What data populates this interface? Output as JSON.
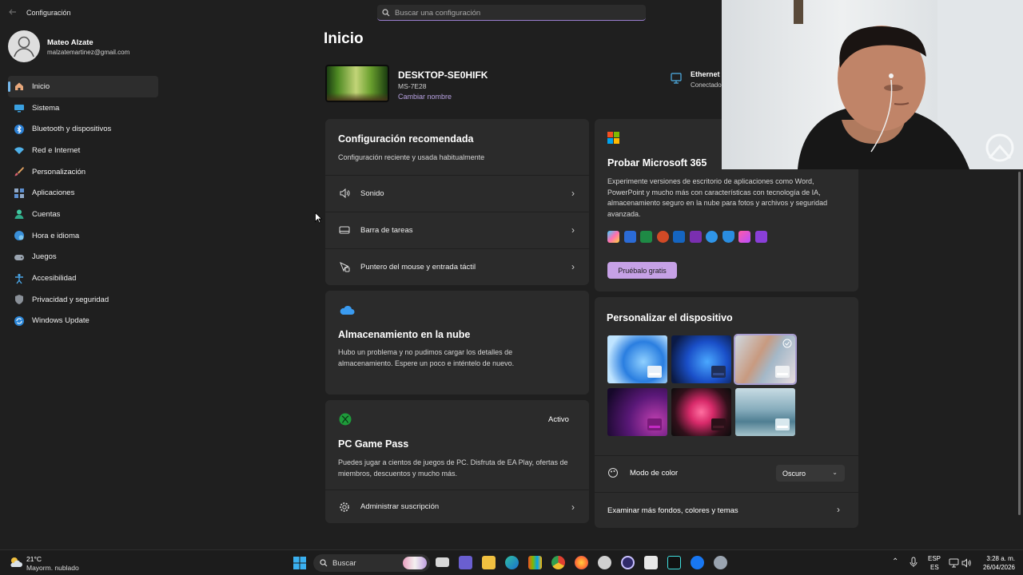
{
  "app": {
    "title": "Configuración"
  },
  "search": {
    "placeholder": "Buscar una configuración"
  },
  "user": {
    "name": "Mateo Alzate",
    "email": "malzatemartinez@gmail.com"
  },
  "sidebar": {
    "items": [
      {
        "label": "Inicio",
        "icon": "home-icon",
        "active": true
      },
      {
        "label": "Sistema",
        "icon": "monitor-icon"
      },
      {
        "label": "Bluetooth y dispositivos",
        "icon": "bluetooth-icon"
      },
      {
        "label": "Red e Internet",
        "icon": "wifi-icon"
      },
      {
        "label": "Personalización",
        "icon": "brush-icon"
      },
      {
        "label": "Aplicaciones",
        "icon": "apps-icon"
      },
      {
        "label": "Cuentas",
        "icon": "person-icon"
      },
      {
        "label": "Hora e idioma",
        "icon": "globe-clock-icon"
      },
      {
        "label": "Juegos",
        "icon": "gamepad-icon"
      },
      {
        "label": "Accesibilidad",
        "icon": "accessibility-icon"
      },
      {
        "label": "Privacidad y seguridad",
        "icon": "shield-icon"
      },
      {
        "label": "Windows Update",
        "icon": "update-icon"
      }
    ]
  },
  "main": {
    "title": "Inicio",
    "device": {
      "name": "DESKTOP-SE0HIFK",
      "model": "MS-7E28",
      "rename": "Cambiar nombre"
    },
    "network": {
      "name": "Ethernet",
      "status": "Conectado"
    },
    "recommended": {
      "title": "Configuración recomendada",
      "subtitle": "Configuración reciente y usada habitualmente",
      "rows": [
        {
          "label": "Sonido",
          "icon": "speaker-icon"
        },
        {
          "label": "Barra de tareas",
          "icon": "taskbar-icon"
        },
        {
          "label": "Puntero del mouse y entrada táctil",
          "icon": "pointer-icon"
        }
      ]
    },
    "cloud": {
      "title": "Almacenamiento en la nube",
      "text": "Hubo un problema y no pudimos cargar los detalles de almacenamiento. Espere un poco e inténtelo de nuevo."
    },
    "gamepass": {
      "title": "PC Game Pass",
      "status": "Activo",
      "text": "Puedes jugar a cientos de juegos de PC. Disfruta de EA Play, ofertas de miembros, descuentos y mucho más.",
      "manage": "Administrar suscripción"
    },
    "m365": {
      "title": "Probar Microsoft 365",
      "text": "Experimente versiones de escritorio de aplicaciones como Word, PowerPoint y mucho más con características con tecnología de IA, almacenamiento seguro en la nube para fotos y archivos y seguridad avanzada.",
      "button": "Pruébalo gratis"
    },
    "personalize": {
      "title": "Personalizar el dispositivo",
      "color_mode_label": "Modo de color",
      "color_mode_value": "Oscuro",
      "more": "Examinar más fondos, colores y temas"
    }
  },
  "taskbar": {
    "weather_temp": "21°C",
    "weather_desc": "Mayorm. nublado",
    "search": "Buscar",
    "lang1": "ESP",
    "lang2": "ES",
    "time": "3:28 a. m.",
    "date": "26/04/2026"
  },
  "colors": {
    "accent": "#c6a1e6",
    "nav_indicator": "#76b9ed",
    "background": "#1f1f1f",
    "card": "#2b2b2b"
  }
}
